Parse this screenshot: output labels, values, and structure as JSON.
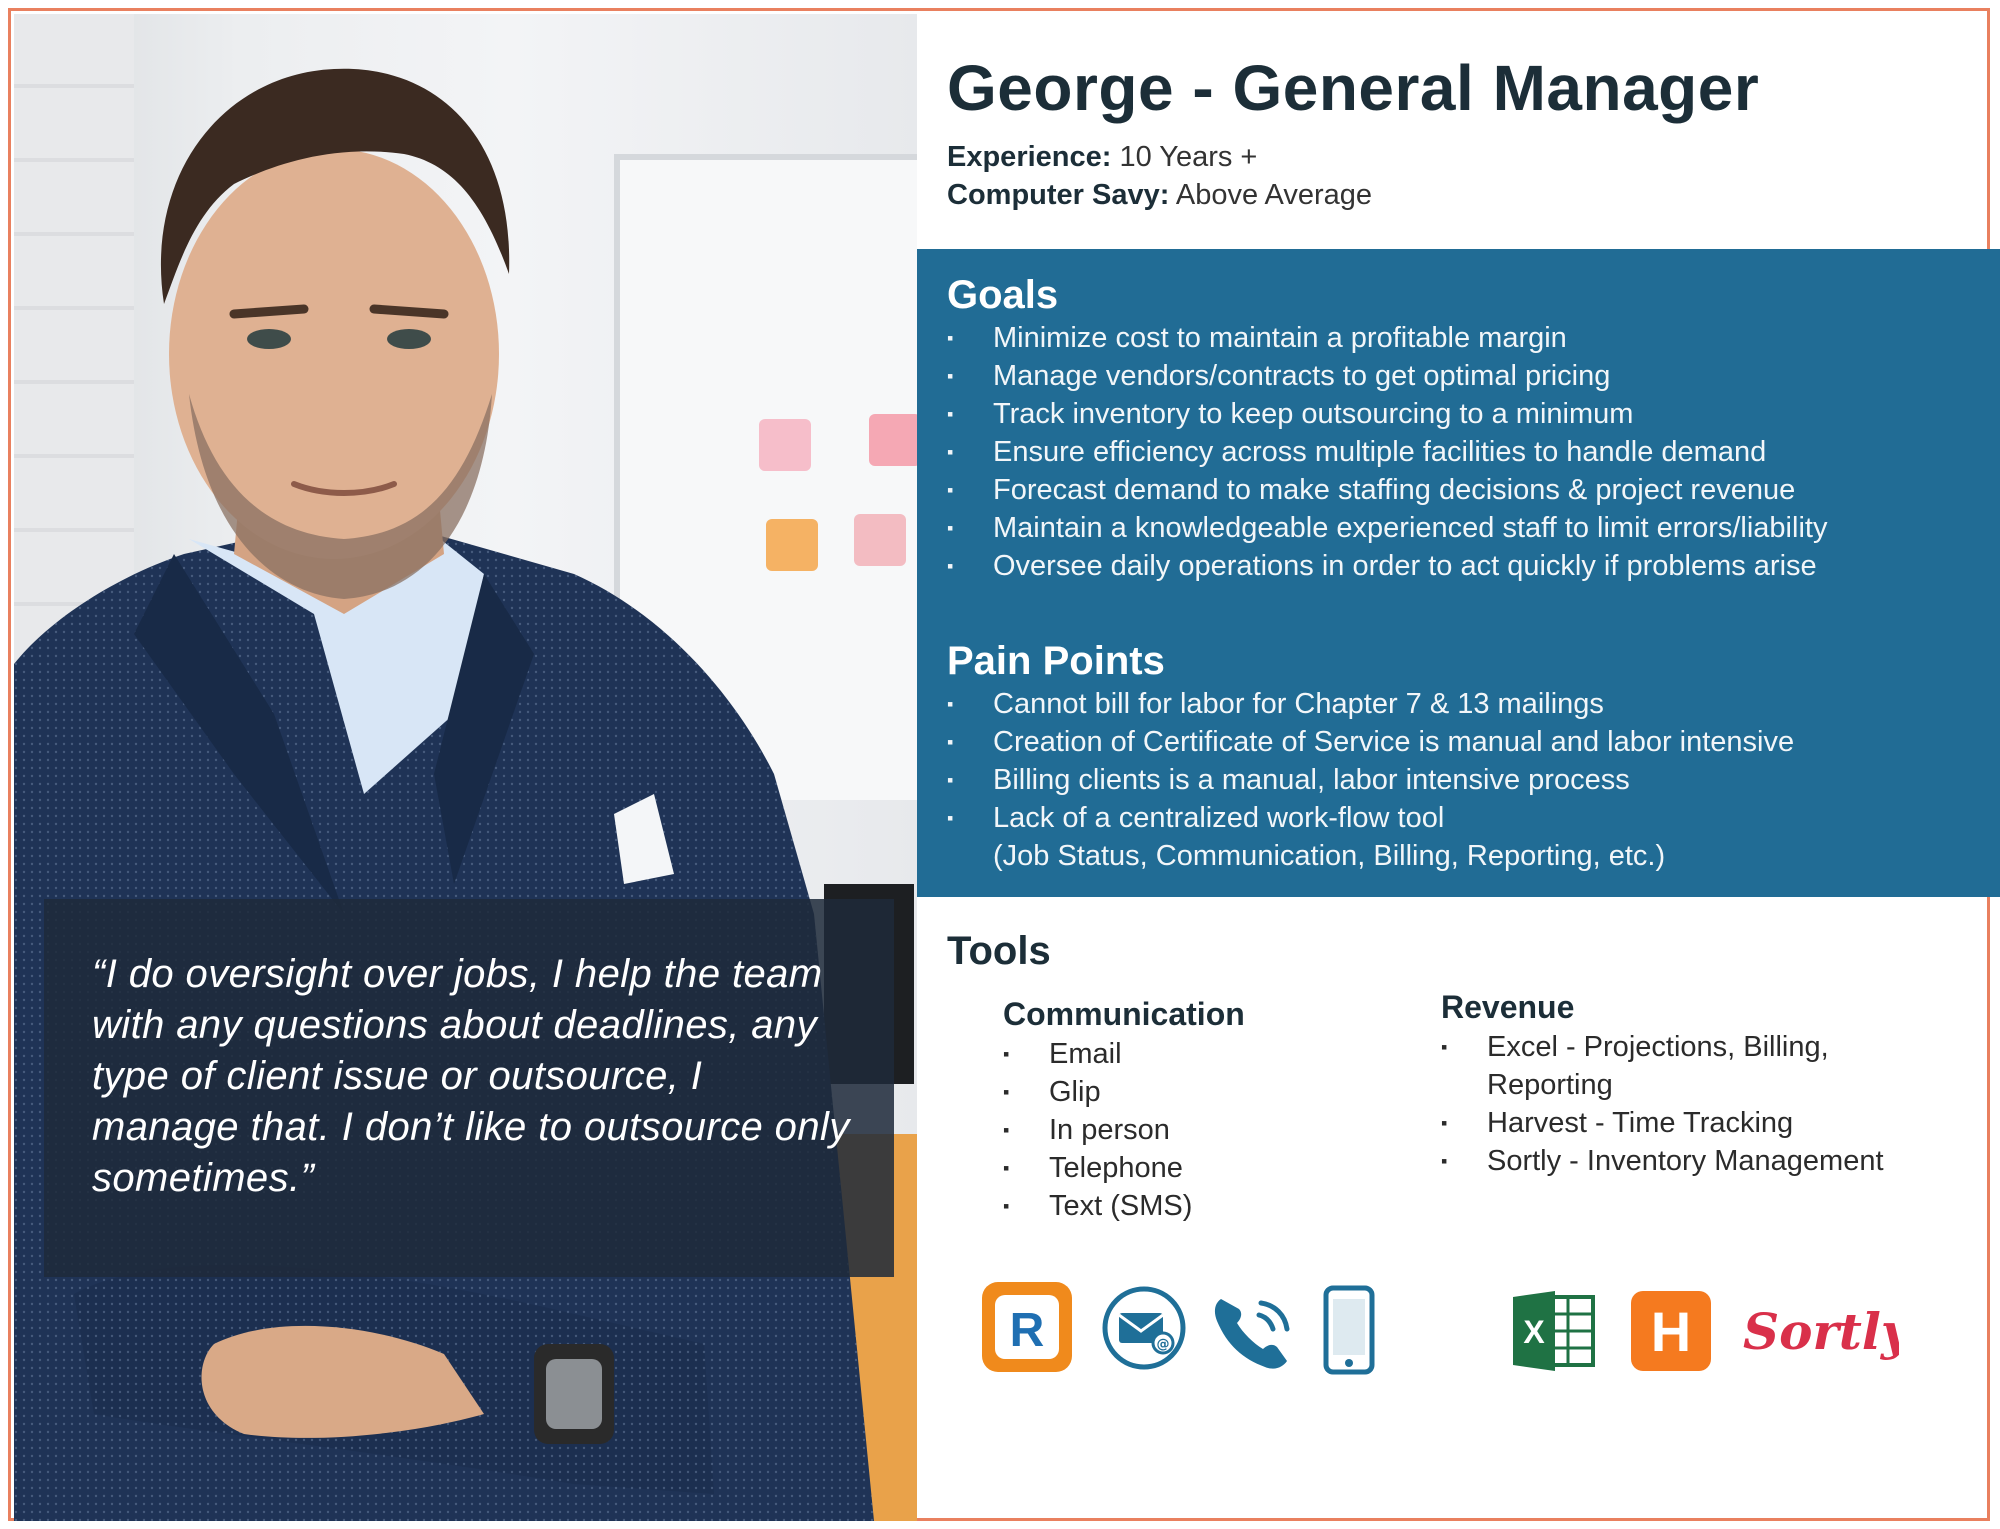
{
  "persona": {
    "name_title": "George - General Manager",
    "experience_label": "Experience:",
    "experience_value": "10 Years +",
    "savvy_label": "Computer Savy:",
    "savvy_value": "Above Average"
  },
  "quote": "“I do oversight over jobs, I help the team with any questions about deadlines, any type of client issue or outsource, I manage that. I don’t like to outsource only sometimes.”",
  "goals": {
    "title": "Goals",
    "items": [
      "Minimize cost to maintain a profitable margin",
      "Manage vendors/contracts to get optimal pricing",
      "Track inventory to keep outsourcing to a minimum",
      "Ensure efficiency across multiple facilities to handle demand",
      "Forecast demand to make staffing decisions & project revenue",
      "Maintain a knowledgeable experienced staff to limit errors/liability",
      "Oversee daily operations in order to act quickly if problems arise"
    ]
  },
  "pain_points": {
    "title": "Pain Points",
    "items": [
      "Cannot bill for labor for Chapter 7 & 13 mailings",
      "Creation of Certificate of Service is manual and labor intensive",
      "Billing clients is a manual, labor intensive process",
      "Lack of a centralized work-flow tool",
      "(Job Status, Communication, Billing, Reporting, etc.)"
    ]
  },
  "tools": {
    "title": "Tools",
    "communication": {
      "title": "Communication",
      "items": [
        "Email",
        "Glip",
        "In person",
        "Telephone",
        "Text (SMS)"
      ]
    },
    "revenue": {
      "title": "Revenue",
      "items": [
        "Excel - Projections, Billing,",
        "Reporting",
        "Harvest - Time Tracking",
        "Sortly - Inventory Management"
      ]
    }
  },
  "logos": {
    "excel_letter": "X",
    "harvest_letter": "H",
    "sortly_wordmark": "Sortly",
    "glip_letter": "R"
  },
  "colors": {
    "accent_border": "#e9805f",
    "section_blue": "#216c95",
    "heading_dark": "#1c2e38",
    "glip_orange": "#f08a1c",
    "excel_green": "#1f7244",
    "harvest_orange": "#f57a1f",
    "sortly_red": "#d9304a"
  }
}
